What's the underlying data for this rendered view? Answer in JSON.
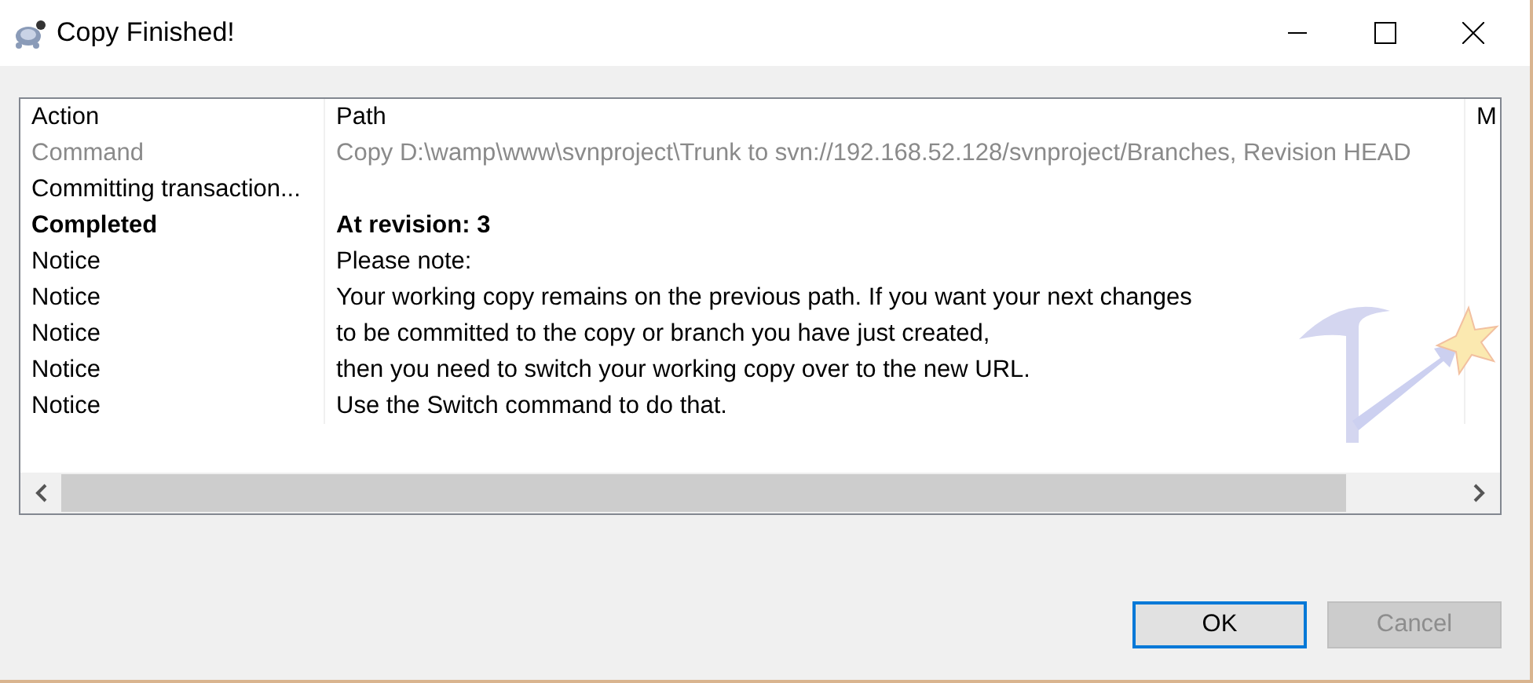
{
  "window": {
    "title": "Copy Finished!"
  },
  "table": {
    "columns": [
      "Action",
      "Path",
      "M"
    ],
    "rows": [
      {
        "kind": "command",
        "action": "Command",
        "path": "Copy D:\\wamp\\www\\svnproject\\Trunk to svn://192.168.52.128/svnproject/Branches, Revision HEAD"
      },
      {
        "kind": "normal",
        "action": "Committing transaction...",
        "path": ""
      },
      {
        "kind": "completed",
        "action": "Completed",
        "path": "At revision: 3"
      },
      {
        "kind": "normal",
        "action": "Notice",
        "path": "Please note:"
      },
      {
        "kind": "normal",
        "action": "Notice",
        "path": "Your working copy remains on the previous path. If you want your next changes"
      },
      {
        "kind": "normal",
        "action": "Notice",
        "path": "to be committed to the copy or branch you have just created,"
      },
      {
        "kind": "normal",
        "action": "Notice",
        "path": "then you need to switch your working copy over to the new URL."
      },
      {
        "kind": "normal",
        "action": "Notice",
        "path": "Use the Switch command to do that."
      }
    ]
  },
  "buttons": [
    {
      "label": "OK",
      "default": true,
      "disabled": false
    },
    {
      "label": "Cancel",
      "default": false,
      "disabled": true
    }
  ]
}
